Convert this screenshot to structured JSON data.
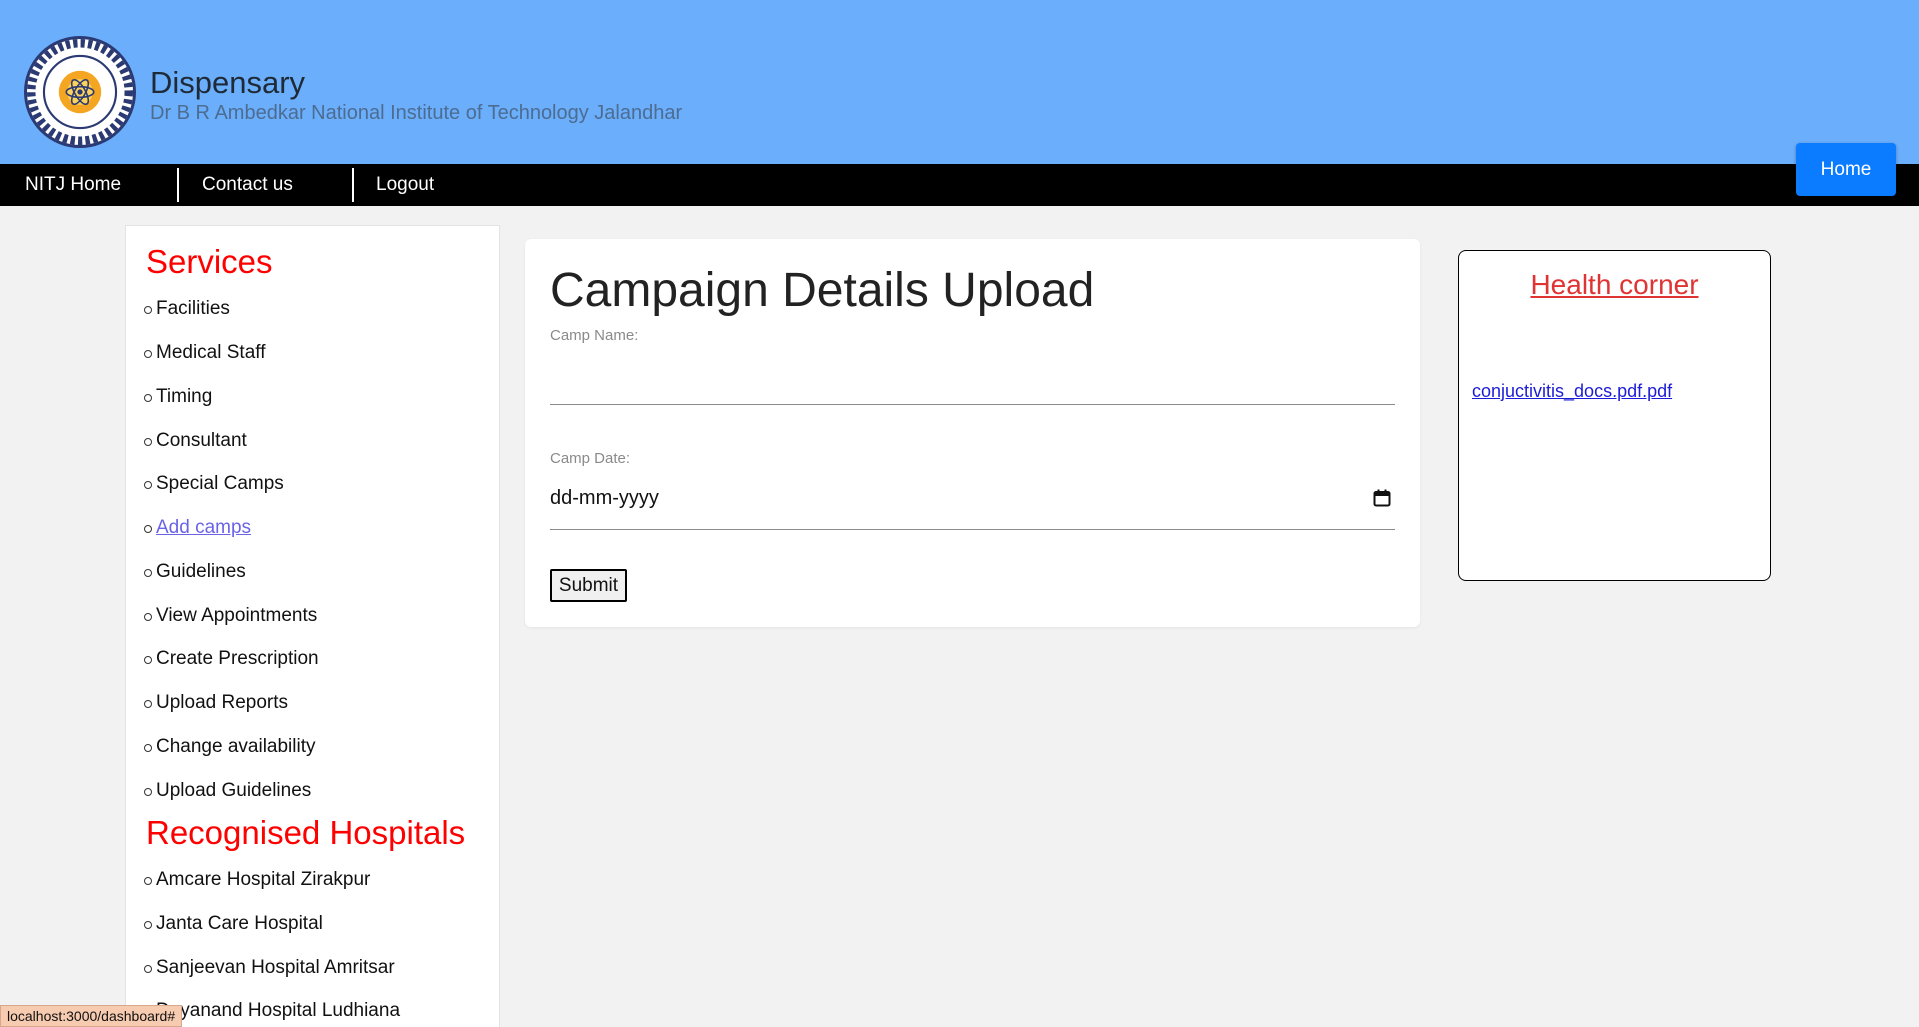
{
  "header": {
    "title": "Dispensary",
    "subtitle": "Dr B R Ambedkar National Institute of Technology Jalandhar",
    "logo_icon": "nitj-logo"
  },
  "nav": {
    "items": [
      "NITJ Home",
      "Contact us",
      "Logout"
    ],
    "home_button": "Home"
  },
  "sidebar": {
    "services_heading": "Services",
    "services": [
      "Facilities",
      "Medical Staff",
      "Timing",
      "Consultant",
      "Special Camps",
      "Add camps",
      "Guidelines",
      "View Appointments",
      "Create Prescription",
      "Upload Reports",
      "Change availability",
      "Upload Guidelines"
    ],
    "hospitals_heading": "Recognised Hospitals",
    "hospitals": [
      "Amcare Hospital Zirakpur",
      "Janta Care Hospital",
      "Sanjeevan Hospital Amritsar",
      "Dayanand Hospital Ludhiana"
    ]
  },
  "form": {
    "title": "Campaign Details Upload",
    "camp_name_label": "Camp Name:",
    "camp_name_value": "",
    "camp_date_label": "Camp Date:",
    "camp_date_value": "dd-mm-yyyy",
    "submit_label": "Submit"
  },
  "health_corner": {
    "title": "Health corner",
    "link": "conjuctivitis_docs.pdf.pdf"
  },
  "status_bar": "localhost:3000/dashboard#",
  "colors": {
    "header_bg": "#6aaefc",
    "nav_bg": "#000000",
    "accent_red": "#ff0000",
    "home_button": "#0b7bff"
  }
}
